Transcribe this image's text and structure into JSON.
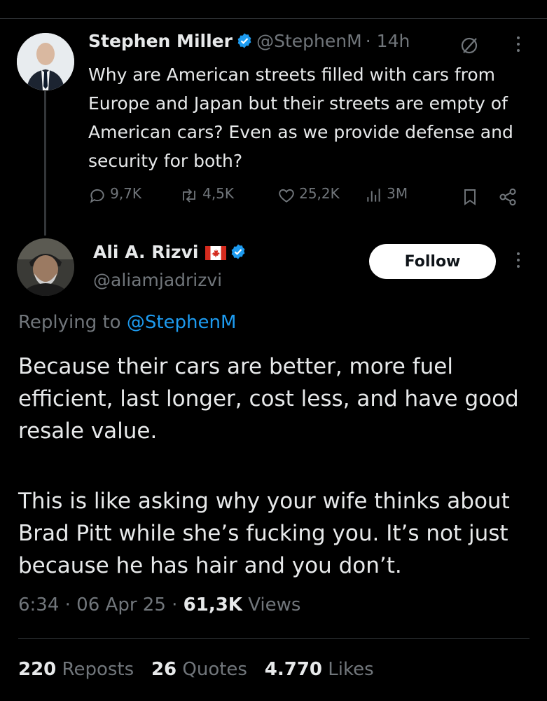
{
  "quoted_tweet": {
    "author_name": "Stephen Miller",
    "handle": "@StephenM",
    "time": "· 14h",
    "text": "Why are American streets filled with cars from Europe and Japan but their streets are empty of American cars? Even as we provide defense and security for both?",
    "replies": "9,7K",
    "reposts": "4,5K",
    "likes": "25,2K",
    "views": "3M"
  },
  "reply_tweet": {
    "author_name": "Ali A. Rizvi",
    "handle": "@aliamjadrizvi",
    "follow_label": "Follow",
    "replying_prefix": "Replying to",
    "replying_handle": "@StephenM",
    "paragraph1": "Because their cars are better, more fuel efficient, last longer, cost less, and have good resale value.",
    "paragraph2": "This is like asking why your wife thinks about Brad Pitt while she’s fucking you. It’s not just because he has hair and you don’t.",
    "timestamp": "6:34 · 06 Apr 25 ·",
    "views_count": "61,3K",
    "views_label": "Views",
    "reposts_count": "220",
    "reposts_label": "Reposts",
    "quotes_count": "26",
    "quotes_label": "Quotes",
    "likes_count": "4.770",
    "likes_label": "Likes"
  },
  "colors": {
    "background": "#000000",
    "text": "#e7e9ea",
    "muted": "#71767b",
    "accent": "#1d9bf0",
    "verified": "#1d9bf0"
  },
  "icons": [
    "verified-badge-icon",
    "no-reply-icon",
    "more-icon",
    "reply-icon",
    "repost-icon",
    "like-icon",
    "views-icon",
    "bookmark-icon",
    "share-icon",
    "canada-flag-icon"
  ]
}
